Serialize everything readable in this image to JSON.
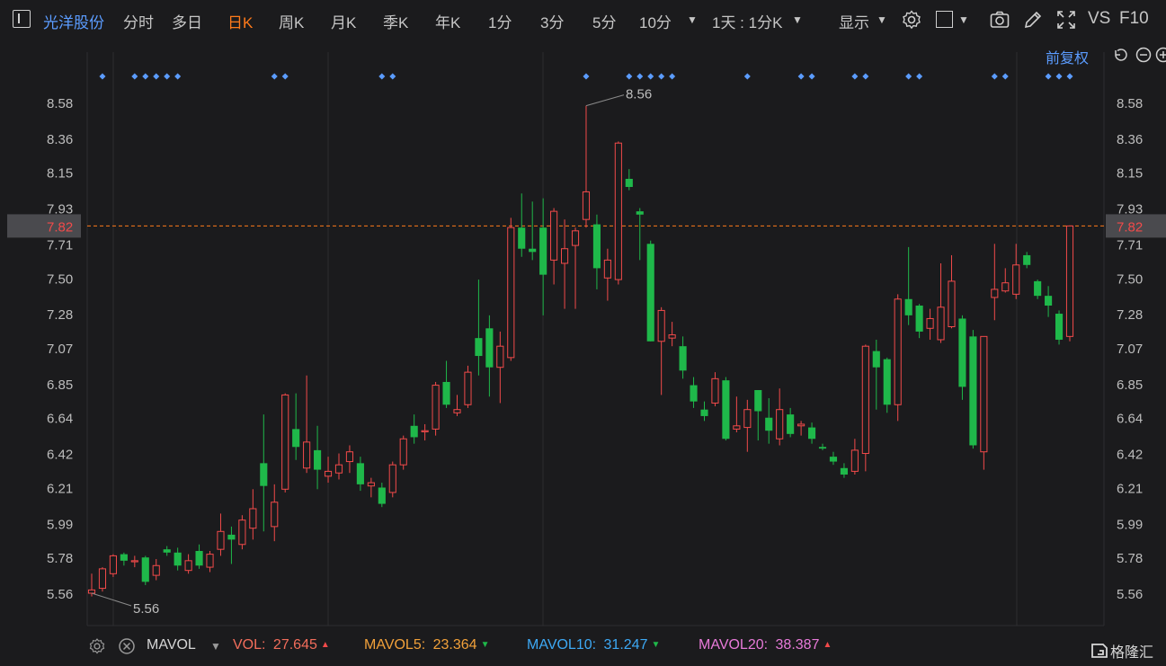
{
  "toolbar": {
    "stock_name": "光洋股份",
    "tabs": [
      "分时",
      "多日",
      "日K",
      "周K",
      "月K",
      "季K",
      "年K",
      "1分",
      "3分",
      "5分",
      "10分"
    ],
    "active_tab": "日K",
    "period_selector": "1天 : 1分K",
    "display_label": "显示",
    "vs_label": "VS",
    "f10_label": "F10"
  },
  "fq_label": "前复权",
  "price_axis": {
    "ticks": [
      "8.58",
      "8.36",
      "8.15",
      "7.93",
      "7.71",
      "7.50",
      "7.28",
      "7.07",
      "6.85",
      "6.64",
      "6.42",
      "6.21",
      "5.99",
      "5.78",
      "5.56"
    ],
    "current_price": "7.82",
    "high_label": "8.56",
    "low_label": "5.56"
  },
  "colors": {
    "up": "#f24a4a",
    "down": "#1fb84a",
    "accent": "#ff7a1a",
    "link": "#5b9cff",
    "vol": "#f26d5b",
    "mavol5": "#f2a13a",
    "mavol10": "#3da9f5",
    "mavol20": "#e87ad9"
  },
  "chart_data": {
    "type": "candlestick",
    "ylim": [
      5.45,
      8.7
    ],
    "high": 8.56,
    "low": 5.56,
    "last": 7.82,
    "candles": [
      {
        "o": 5.56,
        "c": 5.58,
        "h": 5.68,
        "l": 5.54
      },
      {
        "o": 5.59,
        "c": 5.71,
        "h": 5.72,
        "l": 5.57
      },
      {
        "o": 5.68,
        "c": 5.79,
        "h": 5.8,
        "l": 5.66
      },
      {
        "o": 5.8,
        "c": 5.76,
        "h": 5.81,
        "l": 5.73
      },
      {
        "o": 5.76,
        "c": 5.76,
        "h": 5.79,
        "l": 5.72
      },
      {
        "o": 5.78,
        "c": 5.63,
        "h": 5.79,
        "l": 5.61
      },
      {
        "o": 5.67,
        "c": 5.73,
        "h": 5.77,
        "l": 5.64
      },
      {
        "o": 5.83,
        "c": 5.81,
        "h": 5.85,
        "l": 5.79
      },
      {
        "o": 5.81,
        "c": 5.73,
        "h": 5.84,
        "l": 5.7
      },
      {
        "o": 5.7,
        "c": 5.76,
        "h": 5.8,
        "l": 5.68
      },
      {
        "o": 5.82,
        "c": 5.73,
        "h": 5.86,
        "l": 5.71
      },
      {
        "o": 5.72,
        "c": 5.8,
        "h": 5.82,
        "l": 5.69
      },
      {
        "o": 5.83,
        "c": 5.94,
        "h": 6.05,
        "l": 5.79
      },
      {
        "o": 5.92,
        "c": 5.89,
        "h": 5.97,
        "l": 5.74
      },
      {
        "o": 5.86,
        "c": 6.01,
        "h": 6.04,
        "l": 5.83
      },
      {
        "o": 5.96,
        "c": 6.08,
        "h": 6.2,
        "l": 5.89
      },
      {
        "o": 6.36,
        "c": 6.22,
        "h": 6.66,
        "l": 5.94
      },
      {
        "o": 5.97,
        "c": 6.12,
        "h": 6.23,
        "l": 5.88
      },
      {
        "o": 6.2,
        "c": 6.78,
        "h": 6.79,
        "l": 6.18
      },
      {
        "o": 6.57,
        "c": 6.46,
        "h": 6.79,
        "l": 6.38
      },
      {
        "o": 6.33,
        "c": 6.49,
        "h": 6.9,
        "l": 6.3
      },
      {
        "o": 6.44,
        "c": 6.32,
        "h": 6.59,
        "l": 6.2
      },
      {
        "o": 6.28,
        "c": 6.31,
        "h": 6.4,
        "l": 6.24
      },
      {
        "o": 6.3,
        "c": 6.35,
        "h": 6.42,
        "l": 6.26
      },
      {
        "o": 6.37,
        "c": 6.43,
        "h": 6.47,
        "l": 6.3
      },
      {
        "o": 6.36,
        "c": 6.23,
        "h": 6.4,
        "l": 6.19
      },
      {
        "o": 6.22,
        "c": 6.24,
        "h": 6.27,
        "l": 6.15
      },
      {
        "o": 6.21,
        "c": 6.11,
        "h": 6.24,
        "l": 6.09
      },
      {
        "o": 6.18,
        "c": 6.35,
        "h": 6.37,
        "l": 6.15
      },
      {
        "o": 6.35,
        "c": 6.51,
        "h": 6.53,
        "l": 6.32
      },
      {
        "o": 6.59,
        "c": 6.52,
        "h": 6.66,
        "l": 6.48
      },
      {
        "o": 6.56,
        "c": 6.56,
        "h": 6.6,
        "l": 6.5
      },
      {
        "o": 6.57,
        "c": 6.84,
        "h": 6.86,
        "l": 6.53
      },
      {
        "o": 6.86,
        "c": 6.72,
        "h": 6.99,
        "l": 6.7
      },
      {
        "o": 6.67,
        "c": 6.69,
        "h": 6.78,
        "l": 6.65
      },
      {
        "o": 6.72,
        "c": 6.92,
        "h": 6.96,
        "l": 6.7
      },
      {
        "o": 7.13,
        "c": 7.02,
        "h": 7.49,
        "l": 6.9
      },
      {
        "o": 7.19,
        "c": 6.95,
        "h": 7.27,
        "l": 6.77
      },
      {
        "o": 6.95,
        "c": 7.08,
        "h": 7.17,
        "l": 6.73
      },
      {
        "o": 7.01,
        "c": 7.81,
        "h": 7.87,
        "l": 6.99
      },
      {
        "o": 7.81,
        "c": 7.68,
        "h": 8.02,
        "l": 7.63
      },
      {
        "o": 7.68,
        "c": 7.66,
        "h": 7.97,
        "l": 7.61
      },
      {
        "o": 7.81,
        "c": 7.52,
        "h": 7.99,
        "l": 7.27
      },
      {
        "o": 7.61,
        "c": 7.91,
        "h": 7.93,
        "l": 7.46
      },
      {
        "o": 7.59,
        "c": 7.68,
        "h": 7.86,
        "l": 7.31
      },
      {
        "o": 7.7,
        "c": 7.79,
        "h": 7.81,
        "l": 7.31
      },
      {
        "o": 7.86,
        "c": 8.03,
        "h": 8.56,
        "l": 7.81
      },
      {
        "o": 7.83,
        "c": 7.56,
        "h": 7.89,
        "l": 7.43
      },
      {
        "o": 7.5,
        "c": 7.61,
        "h": 7.68,
        "l": 7.36
      },
      {
        "o": 7.49,
        "c": 8.33,
        "h": 8.34,
        "l": 7.46
      },
      {
        "o": 8.11,
        "c": 8.06,
        "h": 8.17,
        "l": 8.04
      },
      {
        "o": 7.91,
        "c": 7.89,
        "h": 7.93,
        "l": 7.61
      },
      {
        "o": 7.71,
        "c": 7.11,
        "h": 7.73,
        "l": 7.11
      },
      {
        "o": 7.11,
        "c": 7.3,
        "h": 7.32,
        "l": 6.78
      },
      {
        "o": 7.13,
        "c": 7.15,
        "h": 7.23,
        "l": 7.08
      },
      {
        "o": 7.08,
        "c": 6.93,
        "h": 7.14,
        "l": 6.88
      },
      {
        "o": 6.84,
        "c": 6.74,
        "h": 6.89,
        "l": 6.7
      },
      {
        "o": 6.69,
        "c": 6.65,
        "h": 6.74,
        "l": 6.62
      },
      {
        "o": 6.73,
        "c": 6.88,
        "h": 6.92,
        "l": 6.71
      },
      {
        "o": 6.87,
        "c": 6.51,
        "h": 6.89,
        "l": 6.5
      },
      {
        "o": 6.57,
        "c": 6.59,
        "h": 6.77,
        "l": 6.55
      },
      {
        "o": 6.58,
        "c": 6.69,
        "h": 6.75,
        "l": 6.43
      },
      {
        "o": 6.81,
        "c": 6.68,
        "h": 6.81,
        "l": 6.5
      },
      {
        "o": 6.64,
        "c": 6.56,
        "h": 6.76,
        "l": 6.48
      },
      {
        "o": 6.51,
        "c": 6.69,
        "h": 6.82,
        "l": 6.47
      },
      {
        "o": 6.66,
        "c": 6.54,
        "h": 6.7,
        "l": 6.52
      },
      {
        "o": 6.59,
        "c": 6.6,
        "h": 6.62,
        "l": 6.53
      },
      {
        "o": 6.58,
        "c": 6.51,
        "h": 6.61,
        "l": 6.48
      },
      {
        "o": 6.46,
        "c": 6.45,
        "h": 6.48,
        "l": 6.44
      },
      {
        "o": 6.4,
        "c": 6.37,
        "h": 6.43,
        "l": 6.35
      },
      {
        "o": 6.33,
        "c": 6.29,
        "h": 6.36,
        "l": 6.27
      },
      {
        "o": 6.31,
        "c": 6.44,
        "h": 6.51,
        "l": 6.29
      },
      {
        "o": 6.42,
        "c": 7.08,
        "h": 7.09,
        "l": 6.31
      },
      {
        "o": 7.05,
        "c": 6.95,
        "h": 7.12,
        "l": 6.69
      },
      {
        "o": 7.0,
        "c": 6.72,
        "h": 7.01,
        "l": 6.67
      },
      {
        "o": 6.72,
        "c": 7.37,
        "h": 7.4,
        "l": 6.62
      },
      {
        "o": 7.37,
        "c": 7.27,
        "h": 7.69,
        "l": 7.21
      },
      {
        "o": 7.33,
        "c": 7.17,
        "h": 7.34,
        "l": 7.13
      },
      {
        "o": 7.19,
        "c": 7.25,
        "h": 7.31,
        "l": 7.12
      },
      {
        "o": 7.12,
        "c": 7.32,
        "h": 7.59,
        "l": 7.1
      },
      {
        "o": 7.2,
        "c": 7.48,
        "h": 7.64,
        "l": 7.19
      },
      {
        "o": 7.25,
        "c": 6.83,
        "h": 7.27,
        "l": 6.75
      },
      {
        "o": 7.14,
        "c": 6.47,
        "h": 7.18,
        "l": 6.45
      },
      {
        "o": 6.43,
        "c": 7.14,
        "h": 7.14,
        "l": 6.32
      },
      {
        "o": 7.38,
        "c": 7.43,
        "h": 7.71,
        "l": 7.24
      },
      {
        "o": 7.42,
        "c": 7.47,
        "h": 7.56,
        "l": 7.41
      },
      {
        "o": 7.4,
        "c": 7.58,
        "h": 7.71,
        "l": 7.37
      },
      {
        "o": 7.64,
        "c": 7.58,
        "h": 7.66,
        "l": 7.56
      },
      {
        "o": 7.48,
        "c": 7.39,
        "h": 7.49,
        "l": 7.37
      },
      {
        "o": 7.39,
        "c": 7.33,
        "h": 7.45,
        "l": 7.26
      },
      {
        "o": 7.28,
        "c": 7.12,
        "h": 7.3,
        "l": 7.09
      },
      {
        "o": 7.14,
        "c": 7.82,
        "h": 7.82,
        "l": 7.11
      }
    ]
  },
  "vol_bar": {
    "indicator": "MAVOL",
    "vol_label": "VOL:",
    "vol_value": "27.645",
    "mavol5_label": "MAVOL5:",
    "mavol5_value": "23.364",
    "mavol10_label": "MAVOL10:",
    "mavol10_value": "31.247",
    "mavol20_label": "MAVOL20:",
    "mavol20_value": "38.387"
  },
  "brand": "格隆汇"
}
